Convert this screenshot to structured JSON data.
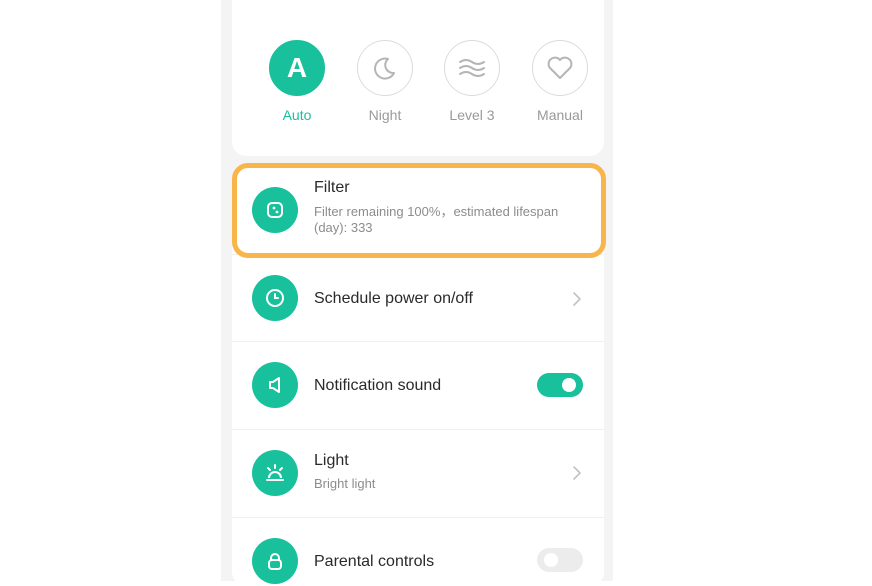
{
  "modes": [
    {
      "label": "Auto",
      "icon": "letter-a-icon",
      "glyph": "A",
      "active": true
    },
    {
      "label": "Night",
      "icon": "moon-icon",
      "active": false
    },
    {
      "label": "Level 3",
      "icon": "wind-waves-icon",
      "active": false
    },
    {
      "label": "Manual",
      "icon": "heart-icon",
      "active": false
    }
  ],
  "settings": {
    "filter": {
      "title": "Filter",
      "subtitle": "Filter remaining 100%，estimated lifespan (day): 333",
      "icon": "filter-icon"
    },
    "schedule": {
      "title": "Schedule power on/off",
      "icon": "clock-icon"
    },
    "notification": {
      "title": "Notification sound",
      "icon": "speaker-icon",
      "enabled": true
    },
    "light": {
      "title": "Light",
      "subtitle": "Bright light",
      "icon": "lamp-icon"
    },
    "parental": {
      "title": "Parental controls",
      "icon": "lock-icon",
      "enabled": false
    }
  },
  "colors": {
    "accent": "#18c09b",
    "highlight": "#f8b54a",
    "muted_text": "#8c8c8c"
  }
}
